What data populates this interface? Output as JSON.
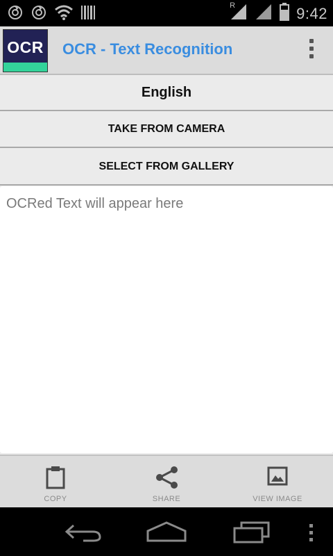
{
  "status_bar": {
    "time": "9:42",
    "roaming_indicator": "R",
    "icons": [
      "sync-icon",
      "sync-icon",
      "wifi-icon",
      "barcode-icon",
      "signal-icon",
      "signal-icon",
      "battery-icon"
    ]
  },
  "action_bar": {
    "logo_text": "OCR",
    "title": "OCR - Text Recognition",
    "overflow_icon": "more-vert-icon"
  },
  "controls": {
    "language": "English",
    "camera_button": "TAKE FROM CAMERA",
    "gallery_button": "SELECT FROM GALLERY"
  },
  "ocr_text": {
    "value": "",
    "placeholder": "OCRed Text will appear here"
  },
  "bottom_bar": {
    "copy_label": "COPY",
    "share_label": "SHARE",
    "view_image_label": "VIEW IMAGE"
  },
  "navigation": {
    "icons": [
      "back-icon",
      "home-icon",
      "recent-apps-icon",
      "menu-icon"
    ]
  },
  "colors": {
    "title": "#3a8de0",
    "logo_bg": "#222255",
    "logo_accent": "#33d39a"
  }
}
